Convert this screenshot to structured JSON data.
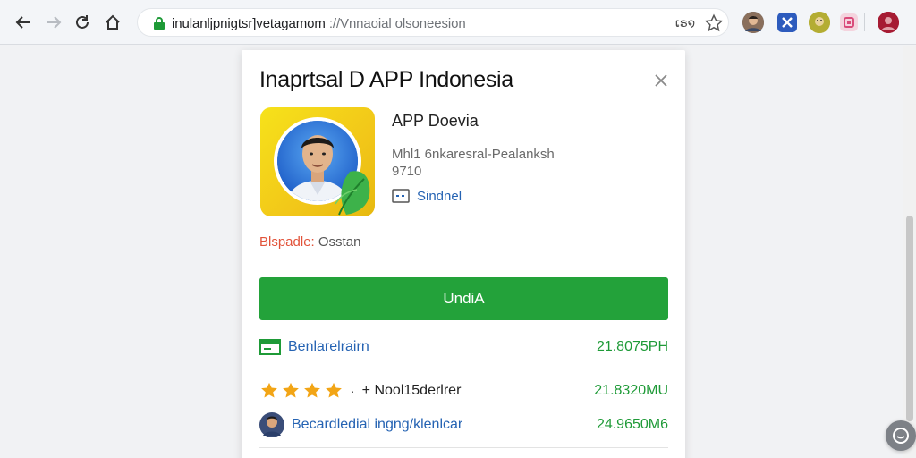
{
  "browser": {
    "url_main": "inulanljpnigtsr]vetagamom",
    "url_rest": " ://Vnnaoial olsoneesion",
    "zoom": "ເຣ໑"
  },
  "dialog": {
    "title": "Inaprtsal D APP Indonesia",
    "app": {
      "name": "APP Doevia",
      "developer": "Mhl1 6nkaresral-Pealanksh",
      "size": "9710",
      "link_label": "Sindnel"
    },
    "status": {
      "label": "Blspadle:",
      "value": "Osstan"
    },
    "primary_button": "UndiA",
    "rows": [
      {
        "icon": "card-icon",
        "name": "Benlarelrairn",
        "amount": "21.8075PH"
      },
      {
        "icon": "star-rating",
        "rating": 4,
        "name": "+ Nool15derlrer",
        "amount": "21.8320MU"
      },
      {
        "icon": "avatar",
        "name": "Becardledial ingng/klenlcar",
        "amount": "24.9650M6"
      }
    ]
  },
  "colors": {
    "accent_green": "#23a23a",
    "amount_green": "#1e9a37",
    "link_blue": "#2563b3",
    "status_red": "#e2533a",
    "star_gold": "#f2a516"
  }
}
